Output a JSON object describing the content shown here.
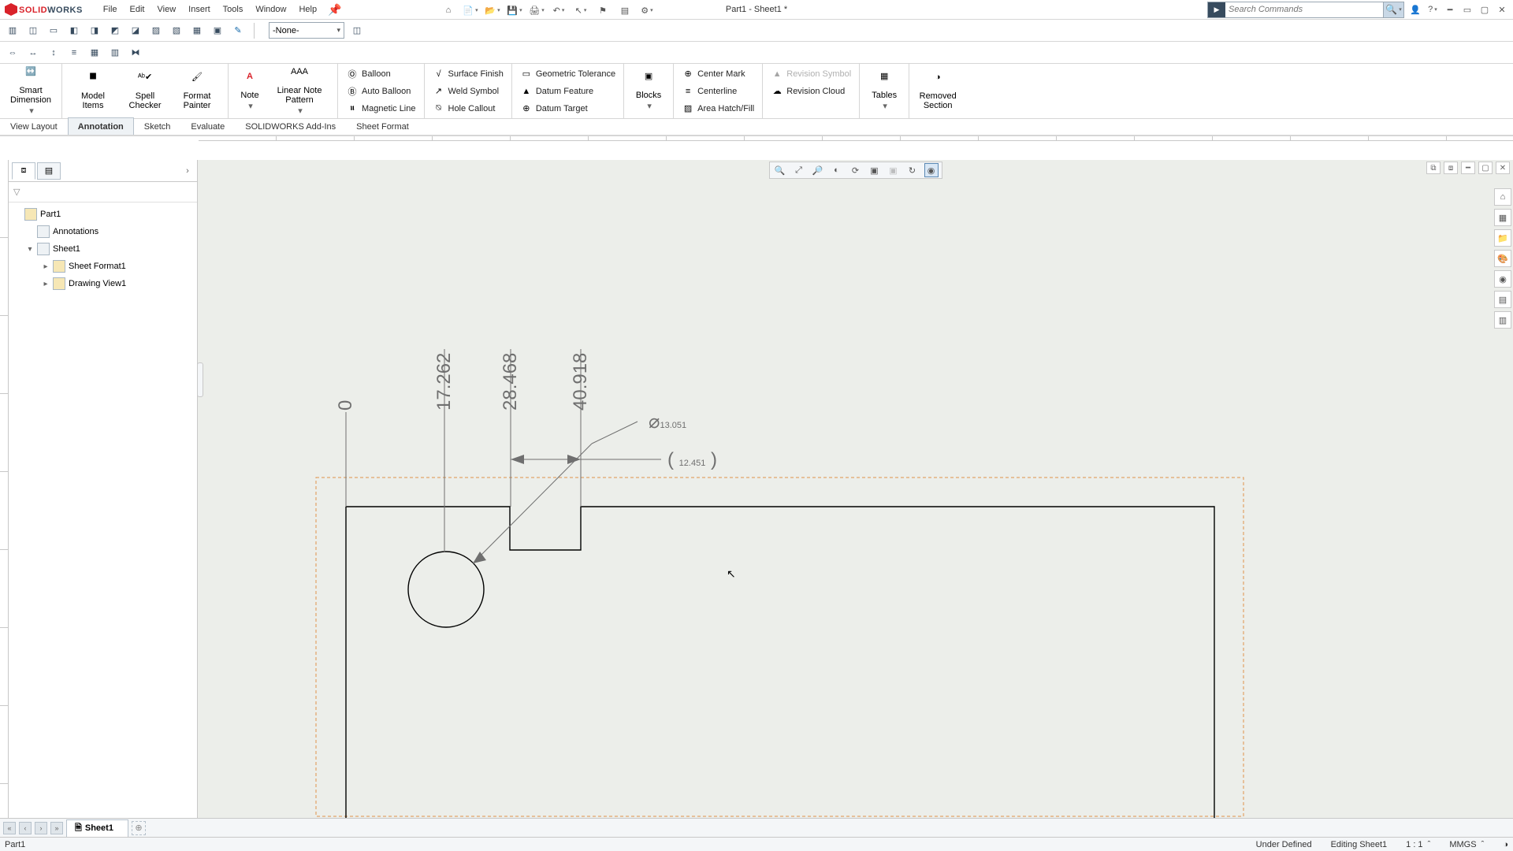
{
  "app": {
    "title": "Part1 - Sheet1 *",
    "logo_text_1": "SOLID",
    "logo_text_2": "WORKS"
  },
  "menus": [
    "File",
    "Edit",
    "View",
    "Insert",
    "Tools",
    "Window",
    "Help"
  ],
  "search": {
    "placeholder": "Search Commands"
  },
  "style_selector": "-None-",
  "ribbon": {
    "smart_dimension": "Smart Dimension",
    "model_items": "Model Items",
    "spell_checker": "Spell Checker",
    "format_painter": "Format Painter",
    "note": "Note",
    "linear_note_pattern": "Linear Note Pattern",
    "balloon": "Balloon",
    "auto_balloon": "Auto Balloon",
    "magnetic_line": "Magnetic Line",
    "surface_finish": "Surface Finish",
    "weld_symbol": "Weld Symbol",
    "hole_callout": "Hole Callout",
    "geo_tol": "Geometric Tolerance",
    "datum_feature": "Datum Feature",
    "datum_target": "Datum Target",
    "blocks": "Blocks",
    "center_mark": "Center Mark",
    "centerline": "Centerline",
    "area_hatch": "Area Hatch/Fill",
    "revision_symbol": "Revision Symbol",
    "revision_cloud": "Revision Cloud",
    "tables": "Tables",
    "removed_section": "Removed Section"
  },
  "tabs": [
    "View Layout",
    "Annotation",
    "Sketch",
    "Evaluate",
    "SOLIDWORKS Add-Ins",
    "Sheet Format"
  ],
  "active_tab_index": 1,
  "tree": {
    "root": "Part1",
    "annotations": "Annotations",
    "sheet": "Sheet1",
    "sheet_format": "Sheet Format1",
    "drawing_view": "Drawing View1"
  },
  "dimensions": {
    "ord0": "0",
    "ord1": "17.262",
    "ord2": "28.468",
    "ord3": "40.918",
    "diameter": "13.051",
    "ref": "12.451"
  },
  "sheet_tab": "Sheet1",
  "status": {
    "doc": "Part1",
    "state": "Under Defined",
    "editing": "Editing Sheet1",
    "scale": "1 : 1",
    "units": "MMGS"
  }
}
